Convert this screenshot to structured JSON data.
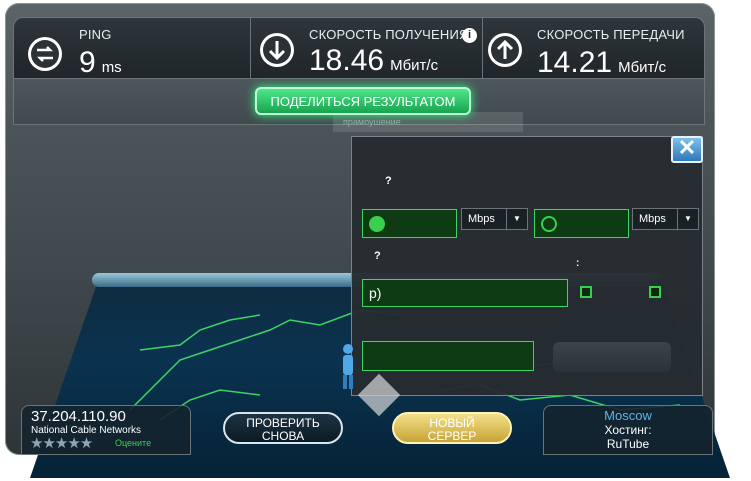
{
  "header": {
    "ping": {
      "label": "PING",
      "value": "9",
      "unit": "ms",
      "icon": "exchange-arrows-icon"
    },
    "download": {
      "label": "СКОРОСТЬ ПОЛУЧЕНИЯ",
      "value": "18.46",
      "unit": "Мбит/с",
      "icon": "download-arrow-icon",
      "info_icon": "info-icon"
    },
    "upload": {
      "label": "СКОРОСТЬ ПЕРЕДАЧИ",
      "value": "14.21",
      "unit": "Мбит/с",
      "icon": "upload-arrow-icon"
    }
  },
  "share": {
    "button_label": "ПОДЕЛИТЬСЯ РЕЗУЛЬТАТОМ",
    "ghost_text": "прамоушение"
  },
  "dialog": {
    "close_label": "✕",
    "question1": "?",
    "question2": "?",
    "colon_mark": ":",
    "download_unit": "Mbps",
    "upload_unit": "Mbps",
    "text_field_value": "р)",
    "dropdown_arrow": "▼"
  },
  "bottom": {
    "ip": "37.204.110.90",
    "isp": "National Cable Networks",
    "rate_label": "Оцените",
    "stars": "★★★★★",
    "retry_line1": "ПРОВЕРИТЬ",
    "retry_line2": "СНОВА",
    "new_line1": "НОВЫЙ",
    "new_line2": "СЕРВЕР",
    "server_city": "Moscow",
    "hosting_label": "Хостинг:",
    "hosting_name": "RuTube"
  },
  "colors": {
    "accent_green": "#39d04f",
    "panel": "#2f363b",
    "map_blue": "#0a3350"
  }
}
